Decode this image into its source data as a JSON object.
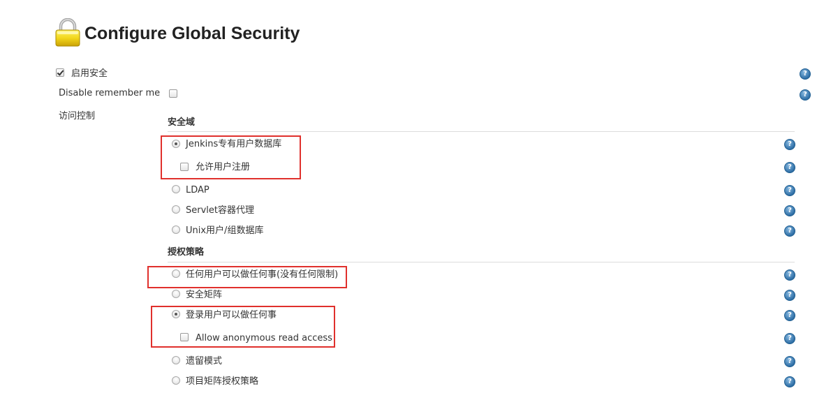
{
  "page": {
    "title": "Configure Global Security"
  },
  "general": {
    "enable_security": {
      "label": "启用安全",
      "checked": true
    },
    "disable_remember_me": {
      "label": "Disable remember me",
      "checked": false
    },
    "access_control_label": "访问控制"
  },
  "security_realm": {
    "title": "安全域",
    "options": [
      {
        "label": "Jenkins专有用户数据库",
        "selected": true
      },
      {
        "label": "LDAP",
        "selected": false
      },
      {
        "label": "Servlet容器代理",
        "selected": false
      },
      {
        "label": "Unix用户/组数据库",
        "selected": false
      }
    ],
    "allow_signup": {
      "label": "允许用户注册",
      "checked": false
    }
  },
  "authorization": {
    "title": "授权策略",
    "options": [
      {
        "label": "任何用户可以做任何事(没有任何限制)",
        "selected": false
      },
      {
        "label": "安全矩阵",
        "selected": false
      },
      {
        "label": "登录用户可以做任何事",
        "selected": true
      },
      {
        "label": "遗留模式",
        "selected": false
      },
      {
        "label": "项目矩阵授权策略",
        "selected": false
      }
    ],
    "allow_anonymous_read": {
      "label": "Allow anonymous read access",
      "checked": false
    }
  },
  "help_icon_glyph": "?",
  "colors": {
    "highlight": "#e0302c",
    "help_icon": "#2f6fa6"
  }
}
